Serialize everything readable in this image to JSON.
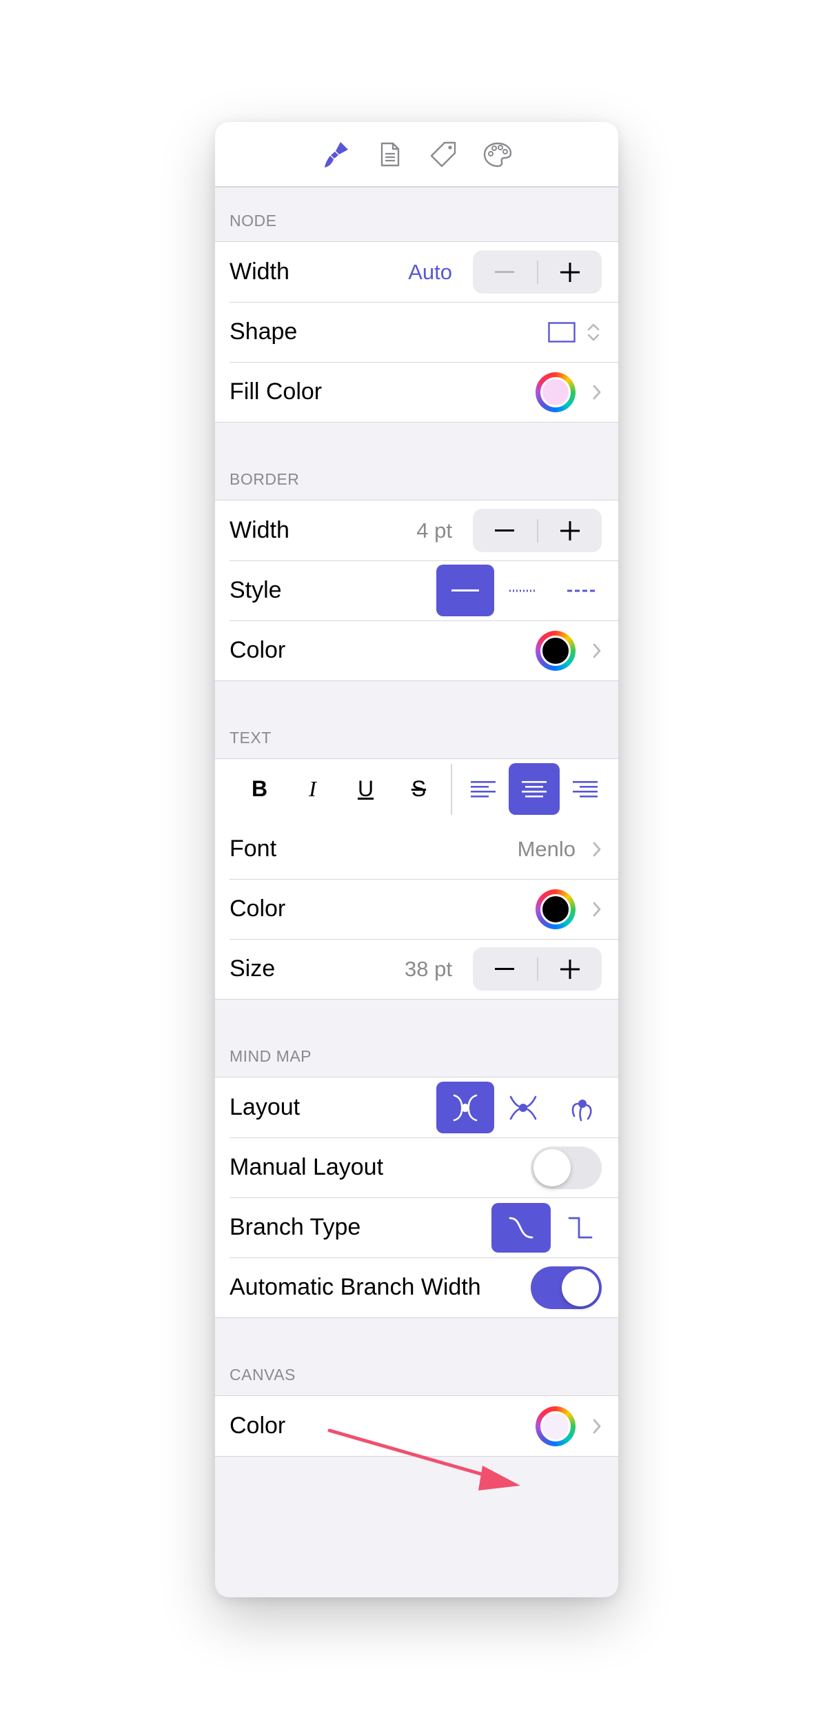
{
  "toolbar": {
    "tabs": [
      {
        "icon": "paintbrush-icon",
        "selected": true
      },
      {
        "icon": "document-icon",
        "selected": false
      },
      {
        "icon": "tag-icon",
        "selected": false
      },
      {
        "icon": "palette-icon",
        "selected": false
      }
    ]
  },
  "colors": {
    "accent": "#5856d6",
    "secondary_text": "#8a8a8e",
    "annotation": "#f0506e"
  },
  "node": {
    "header": "NODE",
    "width_label": "Width",
    "width_value": "Auto",
    "shape_label": "Shape",
    "fill_label": "Fill Color",
    "fill_color": "#f8d7f6"
  },
  "border": {
    "header": "BORDER",
    "width_label": "Width",
    "width_value": "4 pt",
    "style_label": "Style",
    "style_options": [
      "solid",
      "dotted",
      "dashed"
    ],
    "style_selected": "solid",
    "color_label": "Color",
    "color": "#000000"
  },
  "text": {
    "header": "TEXT",
    "format_buttons": [
      "B",
      "I",
      "U",
      "S"
    ],
    "alignment_options": [
      "left",
      "center",
      "right"
    ],
    "alignment_selected": "center",
    "font_label": "Font",
    "font_value": "Menlo",
    "color_label": "Color",
    "color": "#000000",
    "size_label": "Size",
    "size_value": "38 pt"
  },
  "mind_map": {
    "header": "MIND MAP",
    "layout_label": "Layout",
    "layout_options": [
      "balanced",
      "radial",
      "clockwise"
    ],
    "layout_selected": "balanced",
    "manual_layout_label": "Manual Layout",
    "manual_layout_on": false,
    "branch_type_label": "Branch Type",
    "branch_type_options": [
      "curved",
      "angled"
    ],
    "branch_type_selected": "curved",
    "auto_branch_width_label": "Automatic Branch Width",
    "auto_branch_width_on": true
  },
  "canvas": {
    "header": "CANVAS",
    "color_label": "Color",
    "color": "#f6eefa"
  }
}
